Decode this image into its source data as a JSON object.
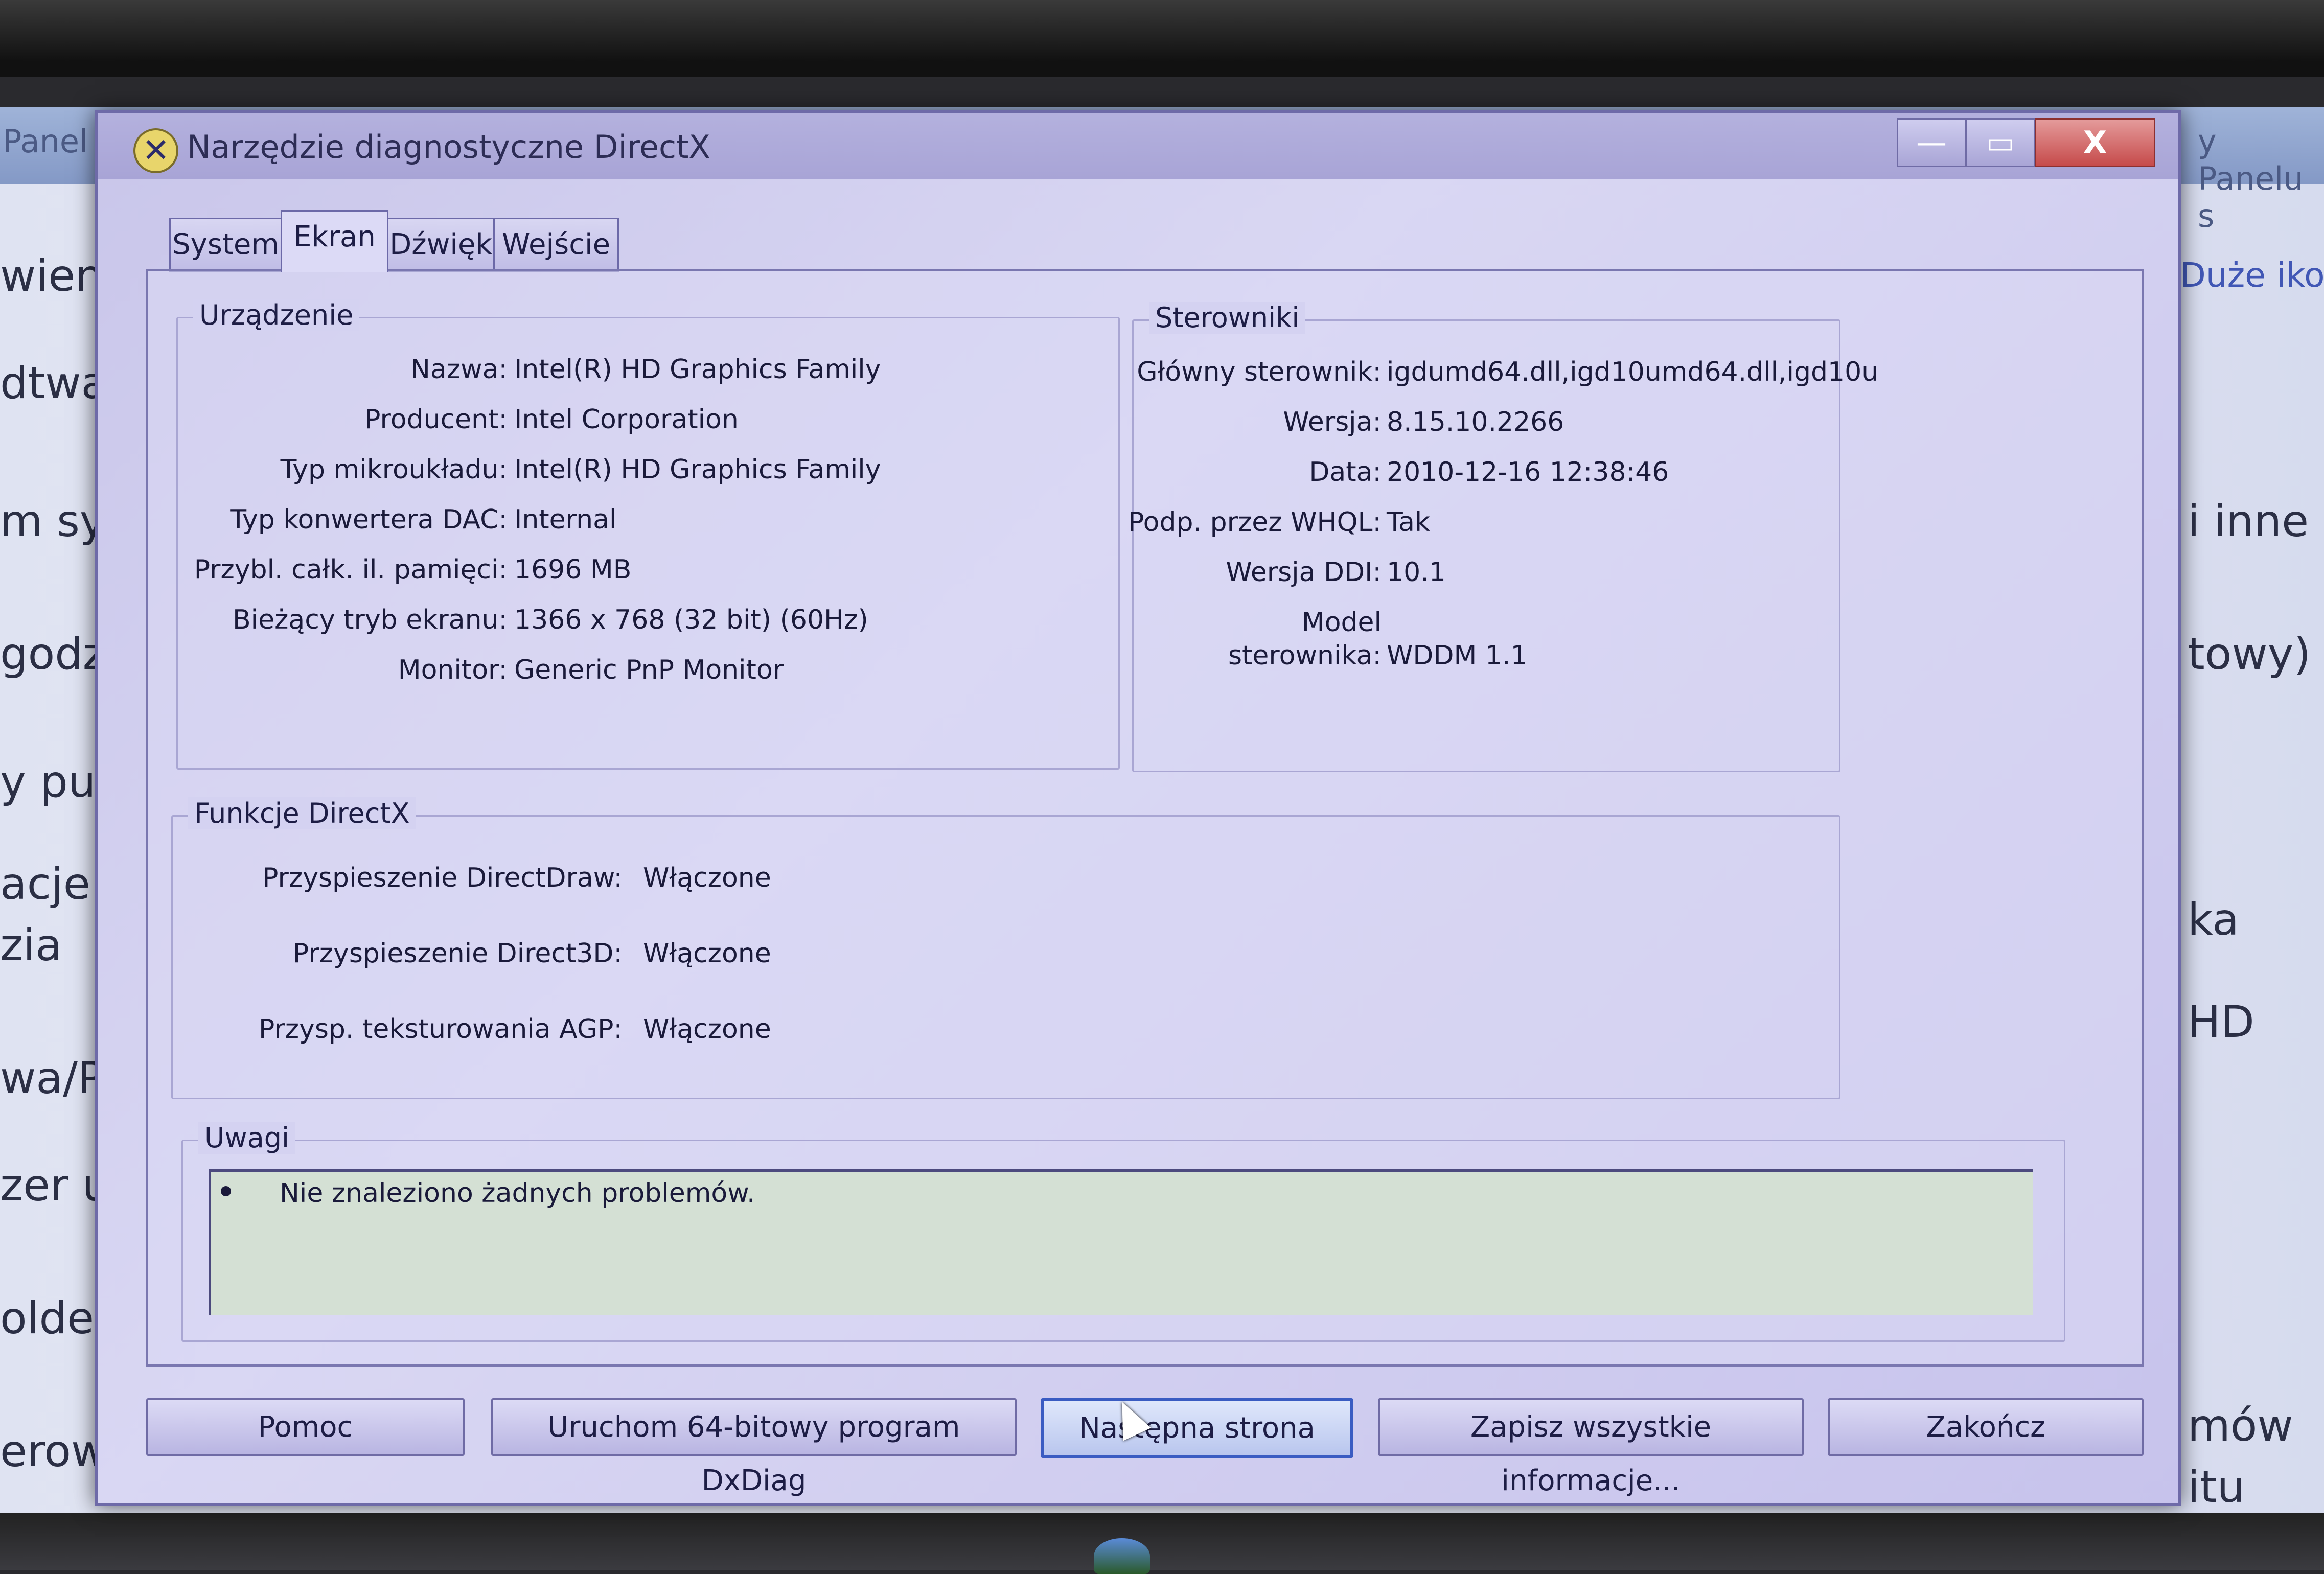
{
  "background": {
    "title_left": "Panel st",
    "title_right": "y Panelu s",
    "left_texts": [
      "wienia",
      "dtwarz",
      "m syn",
      "godzi",
      "y pulp",
      "acje w",
      "zia",
      "wa/Pr",
      "zer ur",
      "older",
      "erow"
    ],
    "right_texts": [
      "Duże ikony",
      "i inne",
      "towy)",
      "ka",
      "HD",
      "mów",
      "itu"
    ]
  },
  "dialog": {
    "title": "Narzędzie diagnostyczne DirectX",
    "title_icon": "directx-icon",
    "window_buttons": {
      "minimize": "—",
      "maximize": "▭",
      "close": "X"
    }
  },
  "tabs": [
    {
      "label": "System",
      "active": false
    },
    {
      "label": "Ekran",
      "active": true
    },
    {
      "label": "Dźwięk",
      "active": false
    },
    {
      "label": "Wejście",
      "active": false
    }
  ],
  "device": {
    "legend": "Urządzenie",
    "rows": [
      {
        "label": "Nazwa:",
        "value": "Intel(R) HD Graphics Family"
      },
      {
        "label": "Producent:",
        "value": "Intel Corporation"
      },
      {
        "label": "Typ mikroukładu:",
        "value": "Intel(R) HD Graphics Family"
      },
      {
        "label": "Typ konwertera DAC:",
        "value": "Internal"
      },
      {
        "label": "Przybl. całk. il. pamięci:",
        "value": "1696 MB"
      },
      {
        "label": "Bieżący tryb ekranu:",
        "value": "1366 x 768 (32 bit) (60Hz)"
      },
      {
        "label": "Monitor:",
        "value": "Generic PnP Monitor"
      }
    ]
  },
  "drivers": {
    "legend": "Sterowniki",
    "rows": [
      {
        "label": "Główny sterownik:",
        "value": "igdumd64.dll,igd10umd64.dll,igd10u"
      },
      {
        "label": "Wersja:",
        "value": "8.15.10.2266"
      },
      {
        "label": "Data:",
        "value": "2010-12-16 12:38:46"
      },
      {
        "label": "Podp. przez WHQL:",
        "value": "Tak"
      },
      {
        "label": "Wersja DDI:",
        "value": "10.1"
      }
    ],
    "model_label_line1": "Model",
    "model_label_line2": "sterownika:",
    "model_value": "WDDM 1.1"
  },
  "directx": {
    "legend": "Funkcje DirectX",
    "rows": [
      {
        "label": "Przyspieszenie DirectDraw:",
        "value": "Włączone"
      },
      {
        "label": "Przyspieszenie Direct3D:",
        "value": "Włączone"
      },
      {
        "label": "Przysp. teksturowania AGP:",
        "value": "Włączone"
      }
    ]
  },
  "notes": {
    "legend": "Uwagi",
    "items": [
      "Nie znaleziono żadnych problemów."
    ]
  },
  "buttons": {
    "help": "Pomoc",
    "run64": "Uruchom 64-bitowy program DxDiag",
    "next": "Następna strona",
    "save": "Zapisz wszystkie informacje...",
    "exit": "Zakończ"
  }
}
